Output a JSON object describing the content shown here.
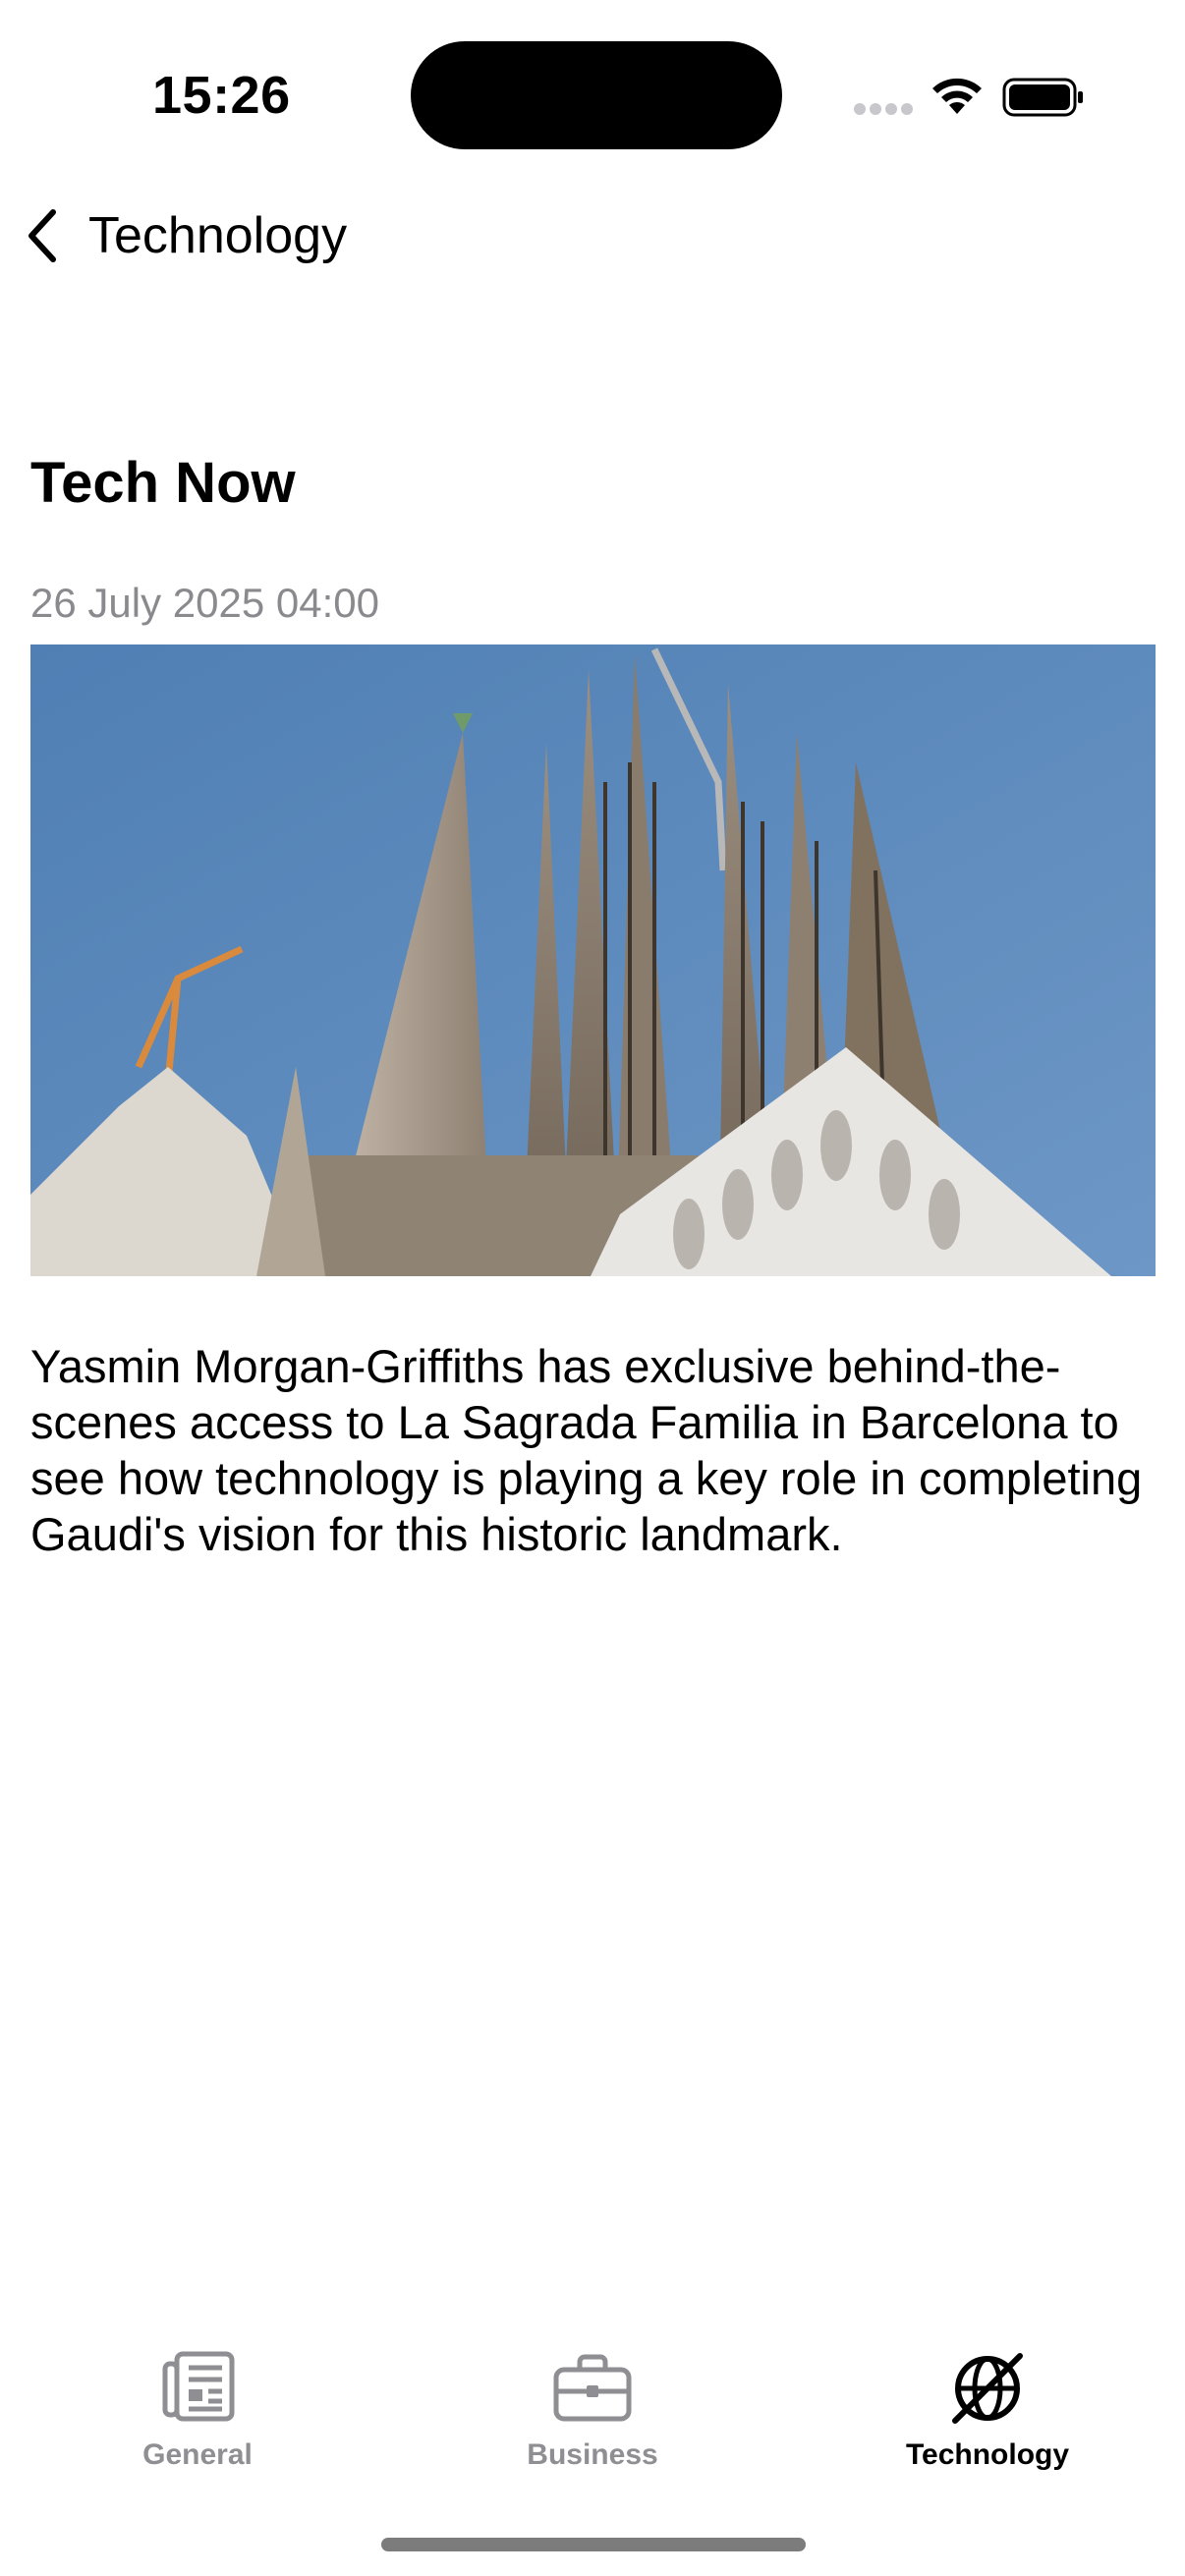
{
  "status_bar": {
    "time": "15:26"
  },
  "nav": {
    "back_label": "Technology"
  },
  "article": {
    "title": "Tech Now",
    "date": "26 July 2025 04:00",
    "summary": "Yasmin Morgan-Griffiths has exclusive behind-the-scenes access to La Sagrada Familia in Barcelona to see how technology is playing a key role in completing Gaudi's vision for this historic landmark."
  },
  "tabs": [
    {
      "label": "General",
      "icon": "newspaper-icon",
      "active": false
    },
    {
      "label": "Business",
      "icon": "briefcase-icon",
      "active": false
    },
    {
      "label": "Technology",
      "icon": "globe-crossed-icon",
      "active": true
    }
  ],
  "colors": {
    "sky": "#5f8dbf",
    "inactive_tab": "#8e8e93",
    "active_tab": "#000000",
    "date_text": "#8a8a8e"
  }
}
